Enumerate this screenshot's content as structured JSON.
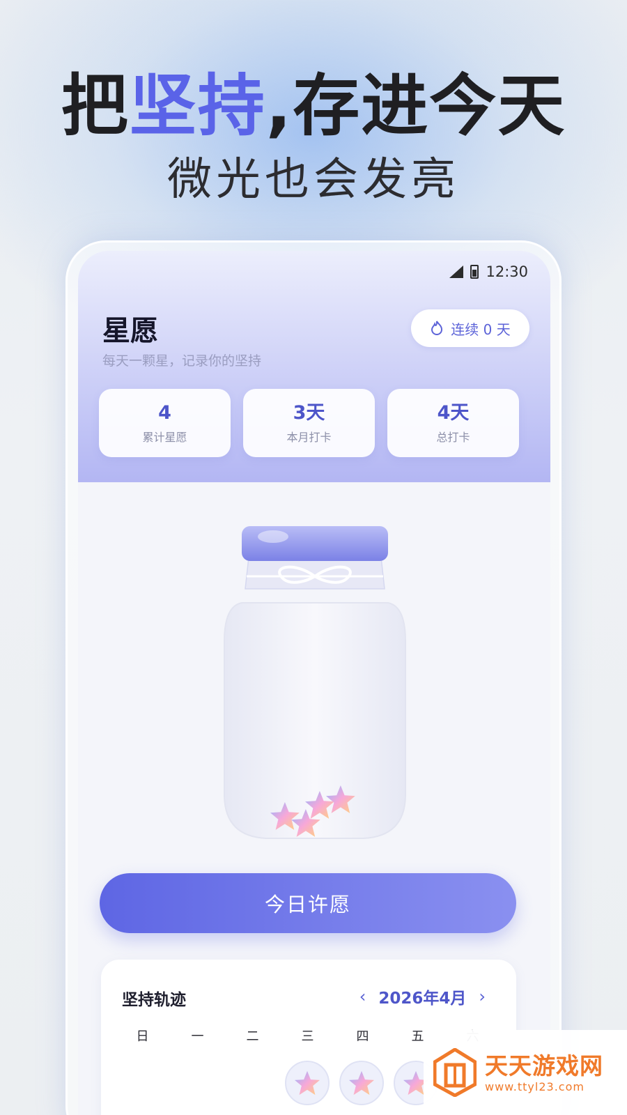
{
  "promo": {
    "headline_part1": "把",
    "headline_accent": "坚持",
    "headline_part2": ",存进今天",
    "subheadline": "微光也会发亮"
  },
  "status_bar": {
    "time": "12:30"
  },
  "app": {
    "title": "星愿",
    "subtitle": "每天一颗星，记录你的坚持",
    "streak_label": "连续 0 天"
  },
  "stats": [
    {
      "value": "4",
      "label": "累计星愿"
    },
    {
      "value": "3天",
      "label": "本月打卡"
    },
    {
      "value": "4天",
      "label": "总打卡"
    }
  ],
  "jar": {
    "stars_count": 4
  },
  "wish_button": {
    "label": "今日许愿"
  },
  "track": {
    "title": "坚持轨迹",
    "month": "2026年4月",
    "weekdays": [
      "日",
      "一",
      "二",
      "三",
      "四",
      "五",
      "六"
    ],
    "checked_days_visible": 3
  },
  "watermark": {
    "name": "天天游戏网",
    "url": "www.ttyl23.com"
  },
  "colors": {
    "accent": "#5a63e8",
    "button_start": "#5e66e4",
    "button_end": "#8a90f0",
    "watermark": "#f07a2a"
  }
}
